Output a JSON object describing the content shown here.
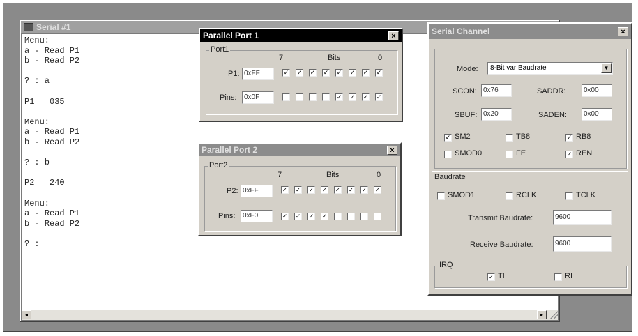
{
  "serial1": {
    "title": "Serial #1",
    "lines": "Menu:\na - Read P1\nb - Read P2\n\n? : a\n\nP1 = 035\n\nMenu:\na - Read P1\nb - Read P2\n\n? : b\n\nP2 = 240\n\nMenu:\na - Read P1\nb - Read P2\n\n? :"
  },
  "pp1": {
    "title": "Parallel Port 1",
    "close": "×",
    "group": "Port1",
    "p_label": "P1:",
    "p_value": "0xFF",
    "pins_label": "Pins:",
    "pins_value": "0x0F",
    "bit_hi": "7",
    "bits_label": "Bits",
    "bit_lo": "0",
    "p_bits": [
      true,
      true,
      true,
      true,
      true,
      true,
      true,
      true
    ],
    "pins_bits": [
      false,
      false,
      false,
      false,
      true,
      true,
      true,
      true
    ]
  },
  "pp2": {
    "title": "Parallel Port 2",
    "close": "×",
    "group": "Port2",
    "p_label": "P2:",
    "p_value": "0xFF",
    "pins_label": "Pins:",
    "pins_value": "0xF0",
    "bit_hi": "7",
    "bits_label": "Bits",
    "bit_lo": "0",
    "p_bits": [
      true,
      true,
      true,
      true,
      true,
      true,
      true,
      true
    ],
    "pins_bits": [
      true,
      true,
      true,
      true,
      false,
      false,
      false,
      false
    ]
  },
  "sc": {
    "title": "Serial Channel",
    "close": "×",
    "mode_label": "Mode:",
    "mode_value": "8-Bit var Baudrate",
    "scon_label": "SCON:",
    "scon_value": "0x76",
    "saddr_label": "SADDR:",
    "saddr_value": "0x00",
    "sbuf_label": "SBUF:",
    "sbuf_value": "0x20",
    "saden_label": "SADEN:",
    "saden_value": "0x00",
    "flags": {
      "sm2": {
        "label": "SM2",
        "checked": true
      },
      "tb8": {
        "label": "TB8",
        "checked": false
      },
      "rb8": {
        "label": "RB8",
        "checked": true
      },
      "smod0": {
        "label": "SMOD0",
        "checked": false
      },
      "fe": {
        "label": "FE",
        "checked": false
      },
      "ren": {
        "label": "REN",
        "checked": true
      }
    },
    "baud_group": "Baudrate",
    "smod1": {
      "label": "SMOD1",
      "checked": false
    },
    "rclk": {
      "label": "RCLK",
      "checked": false
    },
    "tclk": {
      "label": "TCLK",
      "checked": false
    },
    "tx_label": "Transmit Baudrate:",
    "tx_value": "9600",
    "rx_label": "Receive Baudrate:",
    "rx_value": "9600",
    "irq_group": "IRQ",
    "ti": {
      "label": "TI",
      "checked": true
    },
    "ri": {
      "label": "RI",
      "checked": false
    }
  }
}
